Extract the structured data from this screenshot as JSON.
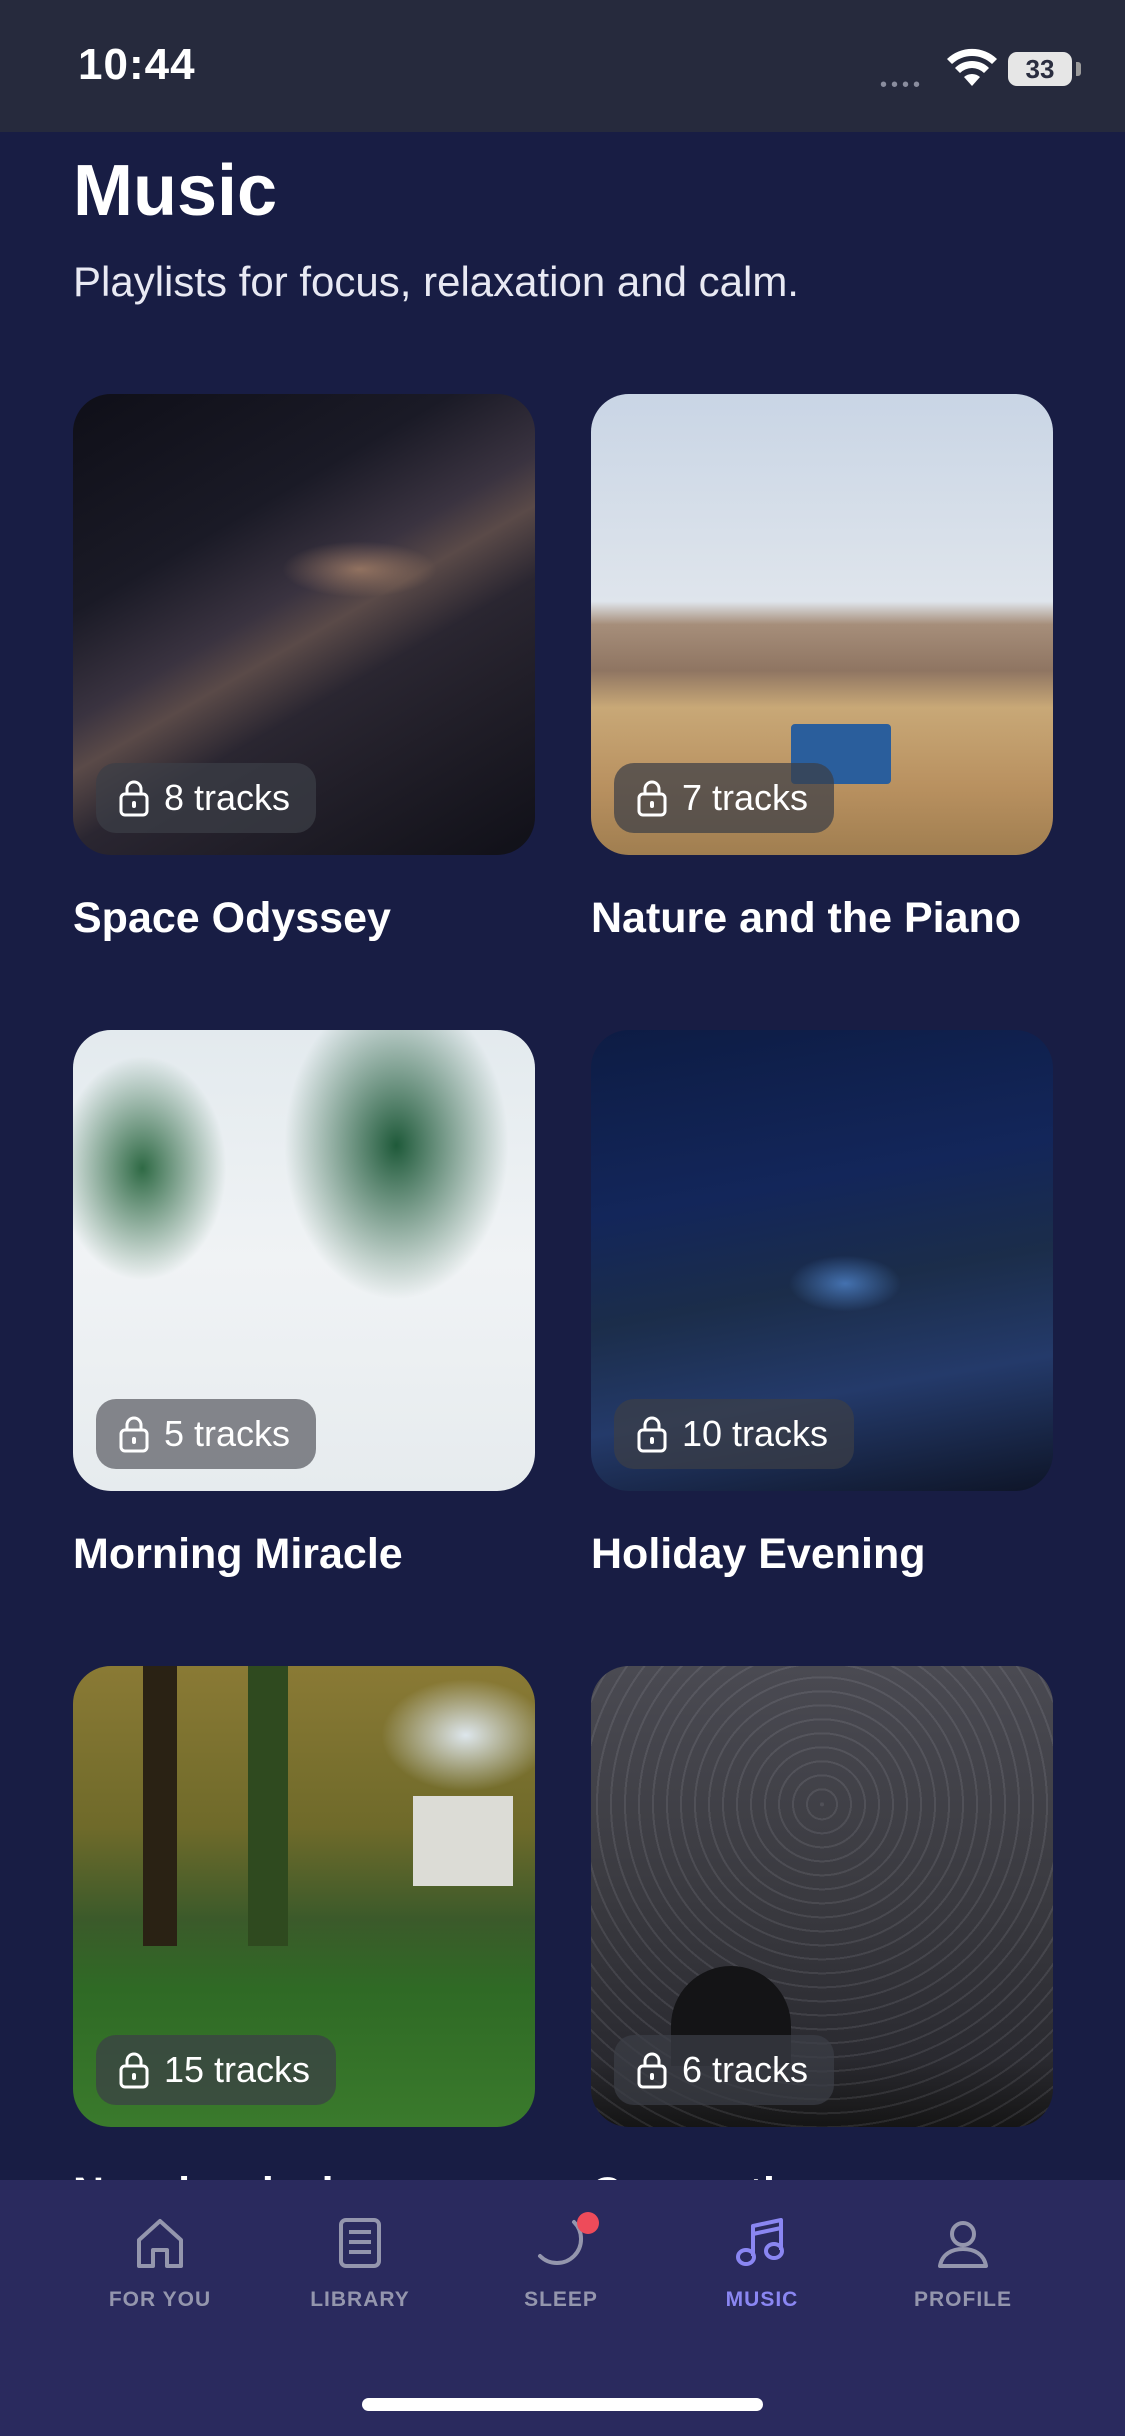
{
  "status_bar": {
    "time": "10:44",
    "battery": "33"
  },
  "header": {
    "title": "Music",
    "subtitle": "Playlists for focus, relaxation and calm."
  },
  "playlists": [
    {
      "title": "Space Odyssey",
      "tracks": "8 tracks"
    },
    {
      "title": "Nature and the Piano",
      "tracks": "7 tracks"
    },
    {
      "title": "Morning Miracle",
      "tracks": "5 tracks"
    },
    {
      "title": "Holiday Evening",
      "tracks": "10 tracks"
    },
    {
      "title": "Neoclassical",
      "tracks": "15 tracks"
    },
    {
      "title": "Connections",
      "tracks": "6 tracks"
    }
  ],
  "tab_bar": {
    "items": [
      {
        "label": "FOR YOU",
        "icon": "home-icon"
      },
      {
        "label": "LIBRARY",
        "icon": "library-icon"
      },
      {
        "label": "SLEEP",
        "icon": "moon-icon"
      },
      {
        "label": "MUSIC",
        "icon": "music-note-icon",
        "active": true
      },
      {
        "label": "PROFILE",
        "icon": "profile-icon"
      }
    ],
    "active_color": "#8a86f2",
    "inactive_color": "#9496ad",
    "notification_color": "#ee4b5a"
  }
}
